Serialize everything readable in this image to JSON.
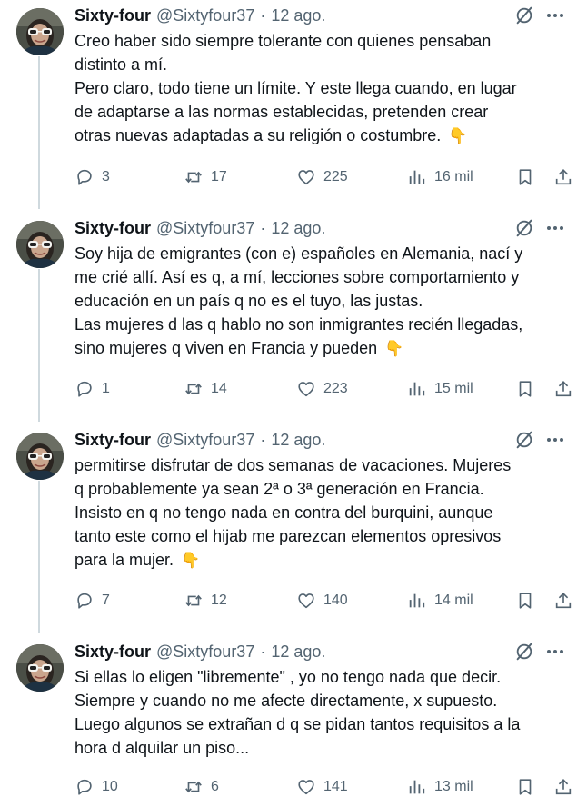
{
  "author": {
    "name": "Sixty-four",
    "handle": "@Sixtyfour37",
    "separator": "·"
  },
  "tweets": [
    {
      "date": "12 ago.",
      "lines": [
        "Creo haber sido siempre tolerante con quienes pensaban",
        "distinto a mí.",
        "Pero claro, todo tiene un límite. Y este llega cuando, en lugar",
        "de adaptarse a las normas establecidas, pretenden crear",
        "otras  nuevas adaptadas a su religión o costumbre."
      ],
      "emoji": "👇",
      "replies": "3",
      "reposts": "17",
      "likes": "225",
      "views": "16 mil"
    },
    {
      "date": "12 ago.",
      "lines": [
        "Soy hija de emigrantes (con e) españoles en Alemania, nací y",
        "me crié allí. Así es q, a mí, lecciones sobre comportamiento y",
        "educación en un país q no es el tuyo, las justas.",
        "Las mujeres d las q hablo no son inmigrantes recién llegadas,",
        "sino mujeres q viven en Francia y pueden"
      ],
      "emoji": "👇",
      "replies": "1",
      "reposts": "14",
      "likes": "223",
      "views": "15 mil"
    },
    {
      "date": "12 ago.",
      "lines": [
        "permitirse disfrutar de dos semanas de vacaciones. Mujeres",
        "q probablemente ya sean 2ª o 3ª generación en Francia.",
        "Insisto en q no tengo nada en contra del burquini, aunque",
        "tanto este como el hijab me parezcan elementos opresivos",
        "para la mujer."
      ],
      "emoji": "👇",
      "replies": "7",
      "reposts": "12",
      "likes": "140",
      "views": "14 mil"
    },
    {
      "date": "12 ago.",
      "lines": [
        "Si ellas lo eligen \"libremente\" , yo no tengo nada que decir.",
        "Siempre y cuando no me afecte directamente, x supuesto.",
        "Luego algunos se extrañan d q se pidan tantos requisitos a la",
        "hora d alquilar un piso..."
      ],
      "emoji": "",
      "replies": "10",
      "reposts": "6",
      "likes": "141",
      "views": "13 mil"
    }
  ],
  "icons": {
    "reply": "reply-icon",
    "repost": "repost-icon",
    "like": "like-icon",
    "views": "views-icon",
    "bookmark": "bookmark-icon",
    "share": "share-icon",
    "grok": "grok-icon",
    "more": "more-icon"
  },
  "colors": {
    "text": "#0f1419",
    "muted": "#536471",
    "thread_line": "#cfd9de",
    "emoji": "#f4c430"
  }
}
